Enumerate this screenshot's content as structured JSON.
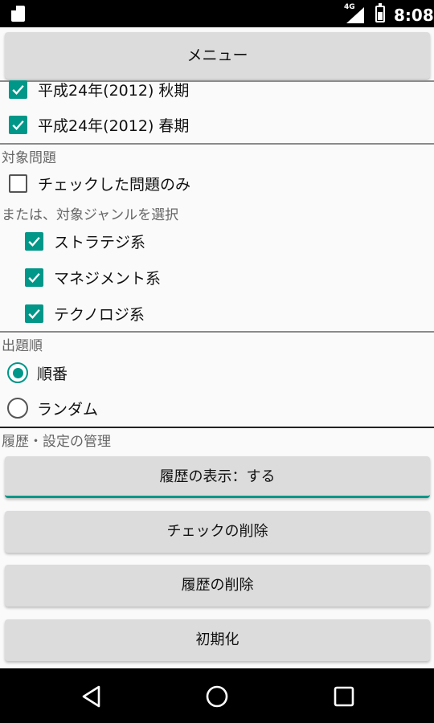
{
  "status_bar": {
    "network": "4G",
    "time": "8:08"
  },
  "menu_button": "メニュー",
  "exam_periods": [
    {
      "label": "平成24年(2012) 秋期",
      "checked": true
    },
    {
      "label": "平成24年(2012) 春期",
      "checked": true
    }
  ],
  "target_section": {
    "title": "対象問題",
    "checked_only": {
      "label": "チェックした問題のみ",
      "checked": false
    },
    "genre_prompt": "または、対象ジャンルを選択",
    "genres": [
      {
        "label": "ストラテジ系",
        "checked": true
      },
      {
        "label": "マネジメント系",
        "checked": true
      },
      {
        "label": "テクノロジ系",
        "checked": true
      }
    ]
  },
  "order_section": {
    "title": "出題順",
    "options": [
      {
        "label": "順番",
        "selected": true
      },
      {
        "label": "ランダム",
        "selected": false
      }
    ]
  },
  "history_section": {
    "title": "履歴・設定の管理",
    "buttons": [
      "履歴の表示：する",
      "チェックの削除",
      "履歴の削除",
      "初期化"
    ]
  },
  "colors": {
    "accent": "#009688",
    "button_bg": "#dcdcdc",
    "background": "#fafafa"
  }
}
